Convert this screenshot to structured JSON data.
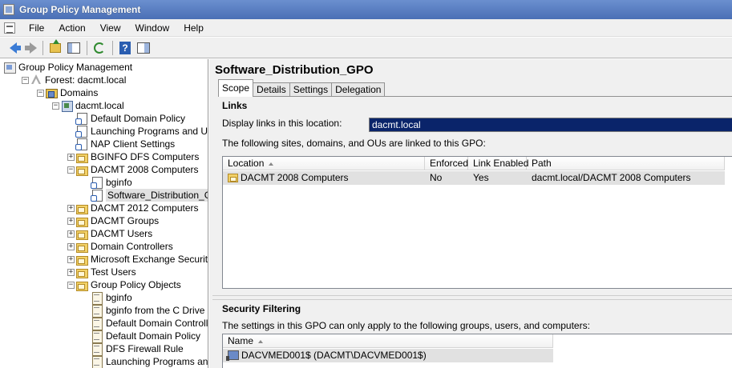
{
  "window": {
    "title": "Group Policy Management"
  },
  "menu": [
    "File",
    "Action",
    "View",
    "Window",
    "Help"
  ],
  "tree": [
    {
      "label": "Group Policy Management",
      "depth": 0,
      "icon": "root-icon",
      "expander": ""
    },
    {
      "label": "Forest: dacmt.local",
      "depth": 1,
      "icon": "forest-icon",
      "expander": "−"
    },
    {
      "label": "Domains",
      "depth": 2,
      "icon": "domains-icon",
      "expander": "−"
    },
    {
      "label": "dacmt.local",
      "depth": 3,
      "icon": "domain-icon",
      "expander": "−"
    },
    {
      "label": "Default Domain Policy",
      "depth": 4,
      "icon": "gpo-link-icon",
      "expander": ""
    },
    {
      "label": "Launching Programs and Unsafe",
      "depth": 4,
      "icon": "gpo-link-icon",
      "expander": ""
    },
    {
      "label": "NAP Client Settings",
      "depth": 4,
      "icon": "gpo-link-icon",
      "expander": ""
    },
    {
      "label": "BGINFO DFS Computers",
      "depth": 4,
      "icon": "folder-icon",
      "expander": "+"
    },
    {
      "label": "DACMT 2008 Computers",
      "depth": 4,
      "icon": "folder-icon",
      "expander": "−"
    },
    {
      "label": "bginfo",
      "depth": 5,
      "icon": "gpo-link-icon",
      "expander": ""
    },
    {
      "label": "Software_Distribution_GPO",
      "depth": 5,
      "icon": "gpo-link-icon",
      "expander": "",
      "selected": true
    },
    {
      "label": "DACMT 2012 Computers",
      "depth": 4,
      "icon": "folder-icon",
      "expander": "+"
    },
    {
      "label": "DACMT Groups",
      "depth": 4,
      "icon": "folder-icon",
      "expander": "+"
    },
    {
      "label": "DACMT Users",
      "depth": 4,
      "icon": "folder-icon",
      "expander": "+"
    },
    {
      "label": "Domain Controllers",
      "depth": 4,
      "icon": "folder-icon",
      "expander": "+"
    },
    {
      "label": "Microsoft Exchange Security Grou",
      "depth": 4,
      "icon": "folder-icon",
      "expander": "+"
    },
    {
      "label": "Test Users",
      "depth": 4,
      "icon": "folder-icon",
      "expander": "+"
    },
    {
      "label": "Group Policy Objects",
      "depth": 4,
      "icon": "folder-icon",
      "expander": "−"
    },
    {
      "label": "bginfo",
      "depth": 5,
      "icon": "gpo-icon",
      "expander": ""
    },
    {
      "label": "bginfo from the C Drive",
      "depth": 5,
      "icon": "gpo-icon",
      "expander": ""
    },
    {
      "label": "Default Domain Controllers Po",
      "depth": 5,
      "icon": "gpo-icon",
      "expander": ""
    },
    {
      "label": "Default Domain Policy",
      "depth": 5,
      "icon": "gpo-icon",
      "expander": ""
    },
    {
      "label": "DFS Firewall Rule",
      "depth": 5,
      "icon": "gpo-icon",
      "expander": ""
    },
    {
      "label": "Launching Programs and Uns",
      "depth": 5,
      "icon": "gpo-icon",
      "expander": ""
    }
  ],
  "detail": {
    "title": "Software_Distribution_GPO",
    "tabs": [
      "Scope",
      "Details",
      "Settings",
      "Delegation"
    ],
    "links_heading": "Links",
    "display_links_label": "Display links in this location:",
    "display_links_value": "dacmt.local",
    "links_note": "The following sites, domains, and OUs are linked to this GPO:",
    "links_columns": [
      "Location",
      "Enforced",
      "Link Enabled",
      "Path"
    ],
    "links_rows": [
      {
        "location": "DACMT 2008 Computers",
        "enforced": "No",
        "link_enabled": "Yes",
        "path": "dacmt.local/DACMT 2008 Computers"
      }
    ],
    "security_heading": "Security Filtering",
    "security_note": "The settings in this GPO can only apply to the following groups, users, and computers:",
    "security_columns": [
      "Name"
    ],
    "security_rows": [
      {
        "name": "DACVMED001$ (DACMT\\DACVMED001$)"
      }
    ]
  }
}
